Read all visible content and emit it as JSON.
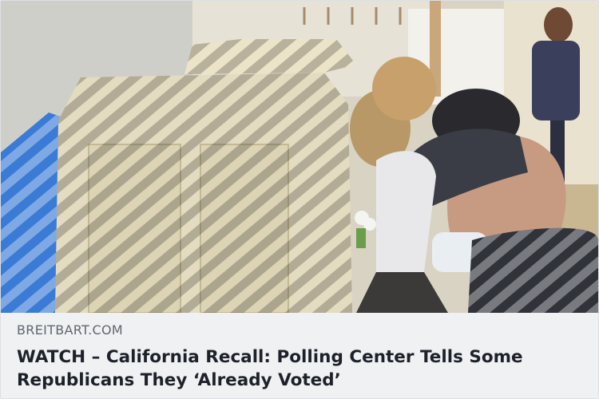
{
  "link_preview": {
    "image": {
      "alt": ""
    },
    "domain": "BREITBART.COM",
    "title": "WATCH – California Recall: Polling Center Tells Some Republicans They ‘Already Voted’"
  }
}
